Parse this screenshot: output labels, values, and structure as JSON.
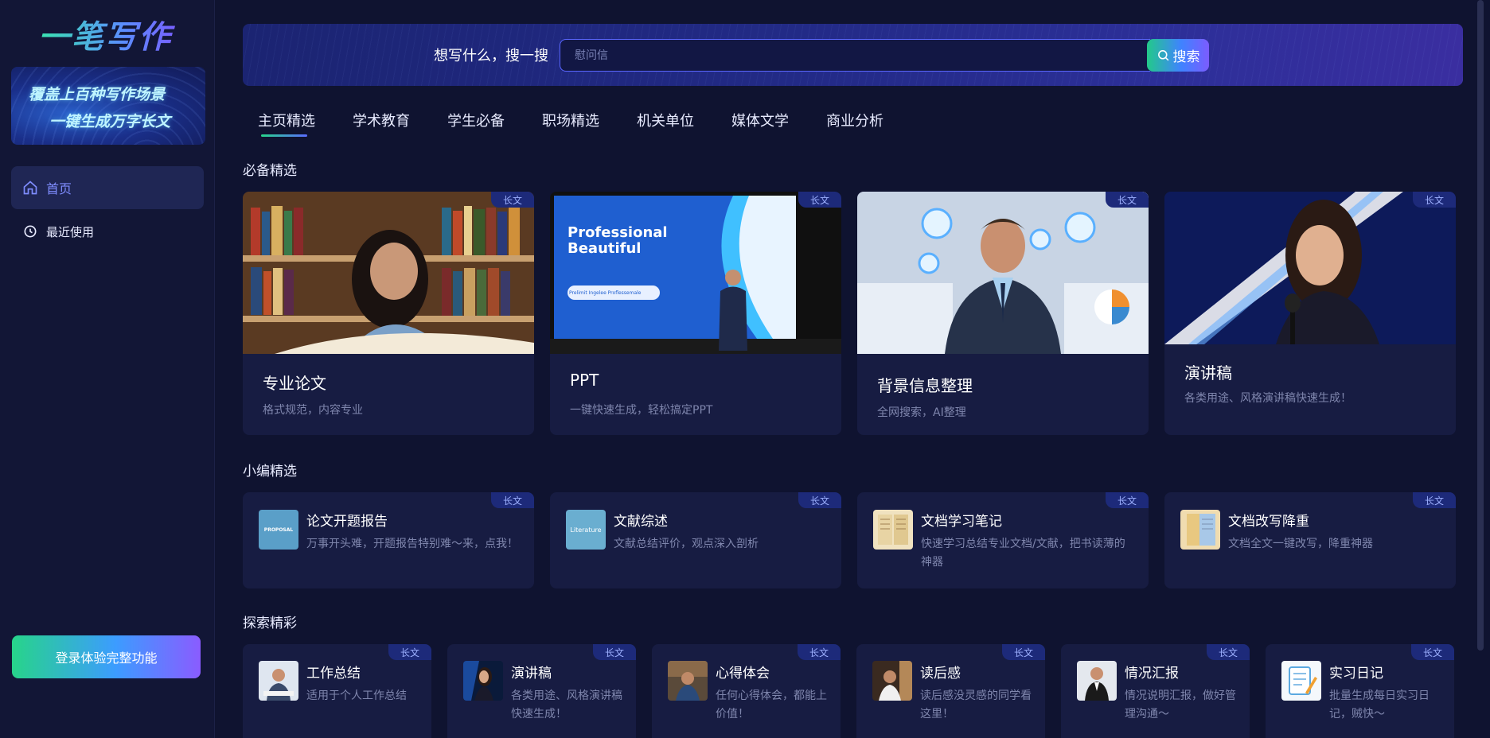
{
  "sidebar": {
    "logo_text": "一笔写作",
    "banner": {
      "line1": "覆盖上百种写作场景",
      "line2": "一键生成万字长文"
    },
    "nav": [
      {
        "label": "首页",
        "icon": "home-icon"
      },
      {
        "label": "最近使用",
        "icon": "clock-icon"
      }
    ],
    "login_button": "登录体验完整功能"
  },
  "search": {
    "label": "想写什么，搜一搜",
    "placeholder": "慰问信",
    "button": "搜索"
  },
  "tabs": [
    "主页精选",
    "学术教育",
    "学生必备",
    "职场精选",
    "机关单位",
    "媒体文学",
    "商业分析"
  ],
  "sections": {
    "featured": "必备精选",
    "editor": "小编精选",
    "explore": "探索精彩"
  },
  "tag_label": "长文",
  "featured_cards": [
    {
      "title": "专业论文",
      "desc": "格式规范，内容专业",
      "image": "student-reading-library"
    },
    {
      "title": "PPT",
      "desc": "一键快速生成，轻松搞定PPT",
      "image": "presenter-slide",
      "slide_title": "Professional Beautiful",
      "slide_button": "Prelimit Ingelee Proflessemale"
    },
    {
      "title": "背景信息整理",
      "desc": "全网搜索，AI整理",
      "image": "businessman-data"
    },
    {
      "title": "演讲稿",
      "desc": "各类用途、风格演讲稿快速生成！",
      "image": "speaker-microphone"
    }
  ],
  "editor_cards": [
    {
      "title": "论文开题报告",
      "desc": "万事开头难，开题报告特别难～来，点我！",
      "thumb_text": "PROPOSAL"
    },
    {
      "title": "文献综述",
      "desc": "文献总结评价，观点深入剖析",
      "thumb_text": "Literature"
    },
    {
      "title": "文档学习笔记",
      "desc": "快速学习总结专业文档/文献，把书读薄的神器"
    },
    {
      "title": "文档改写降重",
      "desc": "文档全文一键改写，降重神器"
    }
  ],
  "explore_cards": [
    {
      "title": "工作总结",
      "desc": "适用于个人工作总结"
    },
    {
      "title": "演讲稿",
      "desc": "各类用途、风格演讲稿快速生成！"
    },
    {
      "title": "心得体会",
      "desc": "任何心得体会，都能上价值！"
    },
    {
      "title": "读后感",
      "desc": "读后感没灵感的同学看这里！"
    },
    {
      "title": "情况汇报",
      "desc": "情况说明汇报，做好管理沟通～"
    },
    {
      "title": "实习日记",
      "desc": "批量生成每日实习日记，贼快～"
    }
  ],
  "colors": {
    "background": "#0f1330",
    "card": "#171c42",
    "accent_green": "#27d48a",
    "accent_blue": "#3f83ff",
    "accent_purple": "#7b5cff"
  }
}
